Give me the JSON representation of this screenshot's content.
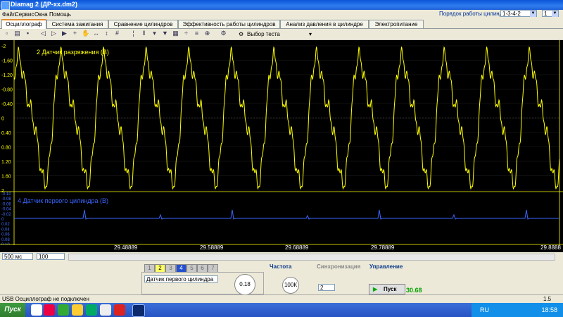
{
  "window": {
    "title": "Diamag 2 (ДР-xx.dm2)"
  },
  "menu": [
    "Файл",
    "Сервис",
    "Окна",
    "Помощь"
  ],
  "cylinder_order": {
    "label": "Порядок работы цилиндров",
    "value": "1-3-4-2",
    "cyl": "1"
  },
  "tabs": [
    "Осциллограф",
    "Система зажигания",
    "Сравнение цилиндров",
    "Эффективность работы цилиндров",
    "Анализ давления в цилиндре",
    "Электропитание"
  ],
  "toolbar": {
    "test_select": "Выбор теста"
  },
  "channel1": {
    "label": "2 Датчик разряжения (В)",
    "yticks": [
      "-2",
      "-1.60",
      "-1.20",
      "-0.80",
      "-0.40",
      "0",
      "0.40",
      "0.80",
      "1.20",
      "1.60",
      "2"
    ]
  },
  "channel2": {
    "label": "4 Датчик первого цилиндра (В)",
    "yticks": [
      "-0.10",
      "-0.08",
      "-0.06",
      "-0.04",
      "-0.02",
      "0",
      "0.02",
      "0.04",
      "0.06",
      "0.08",
      "0.10"
    ]
  },
  "time_axis": [
    "29.48889",
    "29.58889",
    "29.68889",
    "29.78889",
    "29.8888"
  ],
  "controls": {
    "timebase": "500 мс",
    "zoom": "100",
    "channel_numbers": [
      "1",
      "2",
      "3",
      "4",
      "5",
      "6",
      "7"
    ],
    "channel_name": "Датчик первого цилиндра",
    "voltage_value": "0.18",
    "voltage_ticks": [
      "10В",
      "100В",
      "200В",
      "500В",
      "0.1В",
      "0.2В",
      "1В",
      "0.5В"
    ],
    "freq_title": "Частота",
    "freq_value": "100К",
    "freq_ticks": [
      "250К",
      "333К",
      "500К",
      "100К",
      "10К",
      "1К"
    ],
    "sync_title": "Синхронизация",
    "sync_value": "2",
    "control_title": "Управление",
    "start_label": "Пуск",
    "fps": "30.68"
  },
  "status": {
    "text": "USB Осциллограф не подключен",
    "right": "1.5"
  },
  "taskbar": {
    "start": "Пуск",
    "lang": "RU",
    "time": "18:58"
  }
}
